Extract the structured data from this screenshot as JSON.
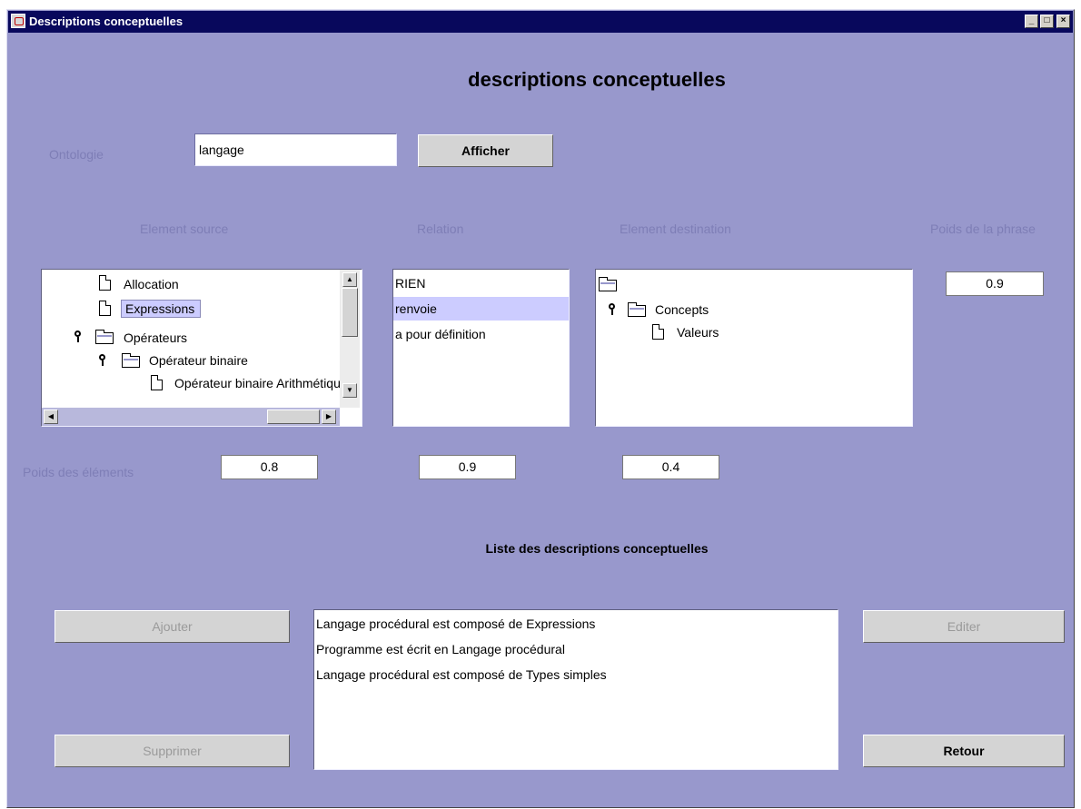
{
  "window": {
    "title": "Descriptions conceptuelles",
    "controls": {
      "minimize": "_",
      "maximize": "□",
      "close": "×"
    }
  },
  "heading": "descriptions conceptuelles",
  "ontology": {
    "label": "Ontologie",
    "value": "langage",
    "button": "Afficher"
  },
  "columns": {
    "source": "Element source",
    "relation": "Relation",
    "destination": "Element destination",
    "sentence_weight": "Poids de la phrase"
  },
  "source_tree": {
    "items": [
      {
        "label": "Allocation",
        "icon": "file-icon"
      },
      {
        "label": "Expressions",
        "icon": "file-icon",
        "selected": true
      },
      {
        "label": "Opérateurs",
        "icon": "folder-icon",
        "expanded": true
      },
      {
        "label": "Opérateur binaire",
        "icon": "folder-icon",
        "expanded": true
      },
      {
        "label": "Opérateur binaire Arithmétique",
        "icon": "file-icon"
      }
    ]
  },
  "relations": {
    "items": [
      "RIEN",
      "renvoie",
      "a pour définition"
    ],
    "selected": "renvoie"
  },
  "destination_tree": {
    "items": [
      {
        "label": "",
        "icon": "folder-icon"
      },
      {
        "label": "Concepts",
        "icon": "folder-icon",
        "expanded": true
      },
      {
        "label": "Valeurs",
        "icon": "file-icon"
      }
    ]
  },
  "sentence_weight_value": "0.9",
  "element_weights": {
    "label": "Poids des éléments",
    "source": "0.8",
    "relation": "0.9",
    "destination": "0.4"
  },
  "list": {
    "title": "Liste des descriptions conceptuelles",
    "items": [
      "Langage procédural est composé de Expressions",
      "Programme est écrit en Langage procédural",
      "Langage procédural est composé de Types simples"
    ]
  },
  "buttons": {
    "add": "Ajouter",
    "delete": "Supprimer",
    "edit": "Editer",
    "back": "Retour"
  },
  "colors": {
    "window_bg": "#9898cc",
    "titlebar": "#08085c",
    "selection": "#ccccff",
    "label": "#7e7eb6"
  }
}
